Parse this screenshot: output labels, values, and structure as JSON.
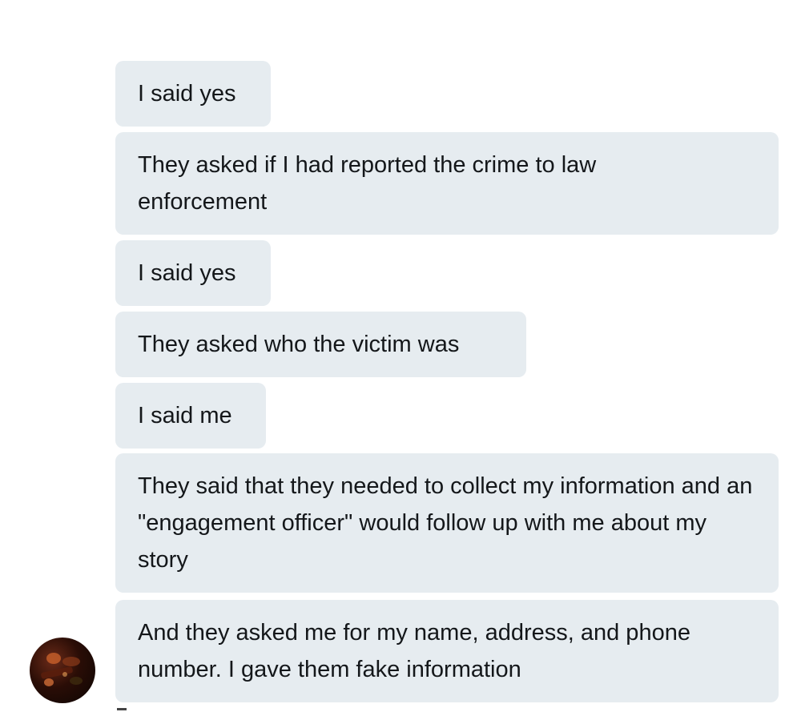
{
  "conversation": {
    "messages": [
      {
        "text": "I said yes"
      },
      {
        "text": "They asked if I had reported the crime to law enforcement"
      },
      {
        "text": "I said yes"
      },
      {
        "text": "They asked who the victim was"
      },
      {
        "text": "I said me"
      },
      {
        "text": "They said that they needed to collect my information and an \"engagement officer\" would follow up with me about my story"
      },
      {
        "text": "And they asked me for my name, address, and phone number. I gave them fake information"
      }
    ]
  },
  "colors": {
    "bubble_background": "#e6ecf0",
    "text": "#14171a",
    "page_background": "#ffffff"
  },
  "icons": {
    "avatar": "avatar-image"
  }
}
